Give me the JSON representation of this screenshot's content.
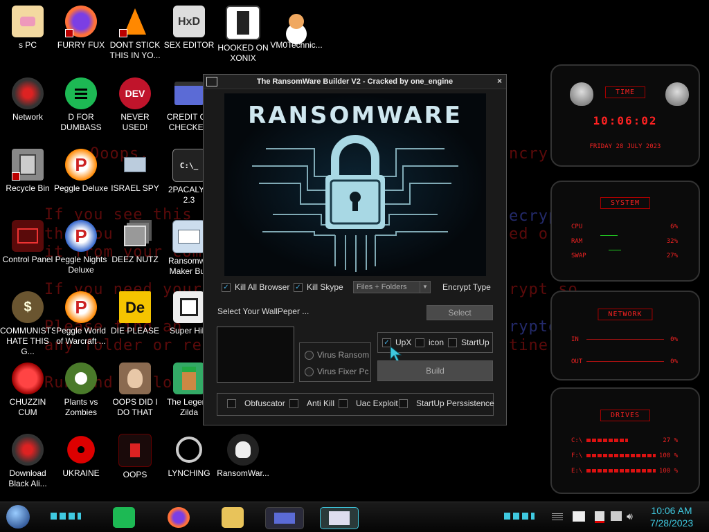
{
  "background_lines": [
    {
      "text": "Ooops,",
      "color": "red"
    },
    {
      "text": "ncry",
      "color": "red"
    },
    {
      "text": "If you see this",
      "color": "red"
    },
    {
      "text": "ecryp",
      "color": "blue"
    },
    {
      "text": "the you",
      "color": "red"
    },
    {
      "text": "ed or",
      "color": "red"
    },
    {
      "text": "it from your com",
      "color": "red"
    },
    {
      "text": "If you need your",
      "color": "red"
    },
    {
      "text": "rypt so",
      "color": "red"
    },
    {
      "text": "Please find an",
      "color": "red"
    },
    {
      "text": "ryptos",
      "color": "blue"
    },
    {
      "text": "any folder or re",
      "color": "red"
    },
    {
      "text": "tine.",
      "color": "red"
    },
    {
      "text": "Run and follo",
      "color": "red"
    }
  ],
  "desktop_icons": [
    {
      "label": "s PC"
    },
    {
      "label": "FURRY FUX"
    },
    {
      "label": "DONT STICK THIS IN YO..."
    },
    {
      "label": "SEX EDITOR"
    },
    {
      "label": "HOOKED ON XONIX"
    },
    {
      "label": "VM0Technic..."
    },
    {
      "label": "Network"
    },
    {
      "label": "D FOR DUMBASS"
    },
    {
      "label": "NEVER USED!"
    },
    {
      "label": "CREDIT CA CHECKER"
    },
    {
      "label": "Recycle Bin"
    },
    {
      "label": "Peggle Deluxe"
    },
    {
      "label": "ISRAEL SPY"
    },
    {
      "label": "2PACALYP 2.3"
    },
    {
      "label": "Control Panel"
    },
    {
      "label": "Peggle Nights Deluxe"
    },
    {
      "label": "DEEZ NUTZ"
    },
    {
      "label": "Ransomwa Maker Buil"
    },
    {
      "label": "COMMUNISTS HATE THIS G..."
    },
    {
      "label": "Peggle World of Warcraft ..."
    },
    {
      "label": "DIE PLEASE"
    },
    {
      "label": "Super Hilo"
    },
    {
      "label": "CHUZZIN CUM"
    },
    {
      "label": "Plants vs Zombies"
    },
    {
      "label": "OOPS DID I DO THAT"
    },
    {
      "label": "The Legend Zilda"
    },
    {
      "label": "Download Black Ali..."
    },
    {
      "label": "UKRAINE"
    },
    {
      "label": "OOPS"
    },
    {
      "label": "LYNCHING"
    },
    {
      "label": "RansomWar..."
    }
  ],
  "icon_glyphs": {
    "dev": "DEV",
    "de": "De",
    "p": "P",
    "money": "$",
    "hxd": "HxD"
  },
  "window": {
    "title": "The RansomWare Builder V2 - Cracked by one_engine",
    "close": "×",
    "hero_title": "RANSOMWARE",
    "kill_all_browser": "Kill All Browser",
    "kill_skype": "Kill Skype",
    "encrypt_select": "Files + Folders",
    "encrypt_type_label": "Encrypt Type",
    "wallpaper_label": "Select Your WallPeper ...",
    "select_button": "Select",
    "radio_virus_ransom": "Virus Ransom",
    "radio_virus_fixer": "Virus Fixer Pc",
    "opt_upx": "UpX",
    "opt_icon": "icon",
    "opt_startup": "StartUp",
    "build_button": "Build",
    "opt_obfuscator": "Obfuscator",
    "opt_anti_kill": "Anti Kill",
    "opt_uac": "Uac Exploit",
    "opt_startup_persist": "StartUp Perssistence",
    "check_mark": "✓"
  },
  "widgets": {
    "time": {
      "title": "TIME",
      "clock": "10:06:02",
      "date": "FRIDAY 28 JULY 2023"
    },
    "system": {
      "title": "SYSTEM",
      "rows": [
        {
          "k": "CPU",
          "v": "6%"
        },
        {
          "k": "RAM",
          "v": "32%"
        },
        {
          "k": "SWAP",
          "v": "27%"
        }
      ]
    },
    "network": {
      "title": "NETWORK",
      "rows": [
        {
          "k": "IN",
          "v": "0%"
        },
        {
          "k": "OUT",
          "v": "0%"
        }
      ]
    },
    "drives": {
      "title": "DRIVES",
      "rows": [
        {
          "k": "C:\\",
          "v": "27 %"
        },
        {
          "k": "F:\\",
          "v": "100 %"
        },
        {
          "k": "E:\\",
          "v": "100 %"
        }
      ]
    }
  },
  "taskbar": {
    "time": "10:06 AM",
    "date": "7/28/2023"
  },
  "colors": {
    "accent_cyan": "#3fc9e0",
    "widget_red": "#ee2222"
  }
}
